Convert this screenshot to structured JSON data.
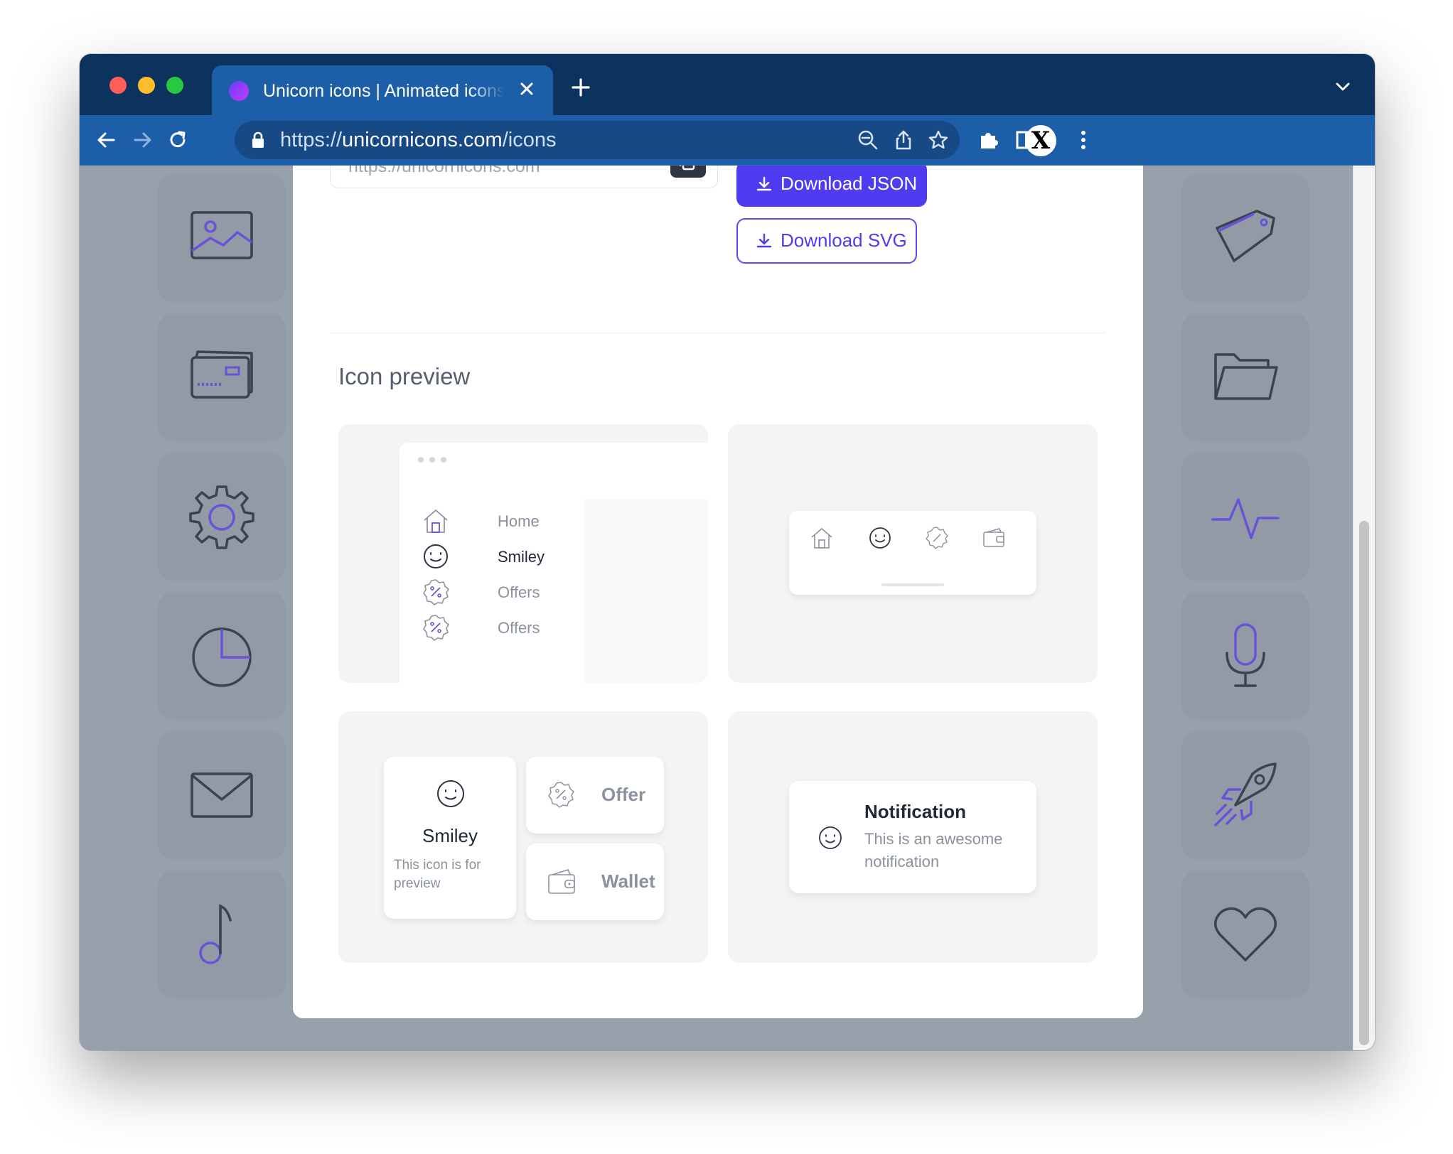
{
  "browser": {
    "tab_title": "Unicorn icons | Animated icons",
    "url_scheme": "https://",
    "url_host": "unicornicons.com",
    "url_path": "/icons",
    "profile_initial": "X",
    "chrome_color": "#0c335e",
    "toolbar_color": "#1d5ea8"
  },
  "page": {
    "url_input_value": "https://unicornicons.com",
    "download_json_label": "Download JSON",
    "download_svg_label": "Download SVG",
    "section_title": "Icon preview",
    "accent_color": "#4f3cf0",
    "menu_preview": {
      "items": [
        {
          "label": "Home",
          "icon": "home-icon"
        },
        {
          "label": "Smiley",
          "icon": "smiley-icon"
        },
        {
          "label": "Offers",
          "icon": "offer-badge-icon"
        },
        {
          "label": "Offers",
          "icon": "offer-badge-icon"
        }
      ]
    },
    "tabbar_preview": {
      "icons": [
        "home-icon",
        "smiley-icon",
        "offer-badge-icon",
        "wallet-icon"
      ]
    },
    "widgets_preview": {
      "smiley_title": "Smiley",
      "smiley_desc": "This icon is for preview",
      "offer_label": "Offer",
      "wallet_label": "Wallet"
    },
    "notification_preview": {
      "title": "Notification",
      "body": "This is an awesome notification"
    }
  },
  "background_icons": {
    "left": [
      "image-icon",
      "credit-card-icon",
      "gear-icon",
      "pie-chart-icon",
      "mail-icon",
      "music-note-icon"
    ],
    "right": [
      "tag-icon",
      "folder-icon",
      "pulse-icon",
      "microphone-icon",
      "rocket-icon",
      "heart-icon"
    ]
  }
}
